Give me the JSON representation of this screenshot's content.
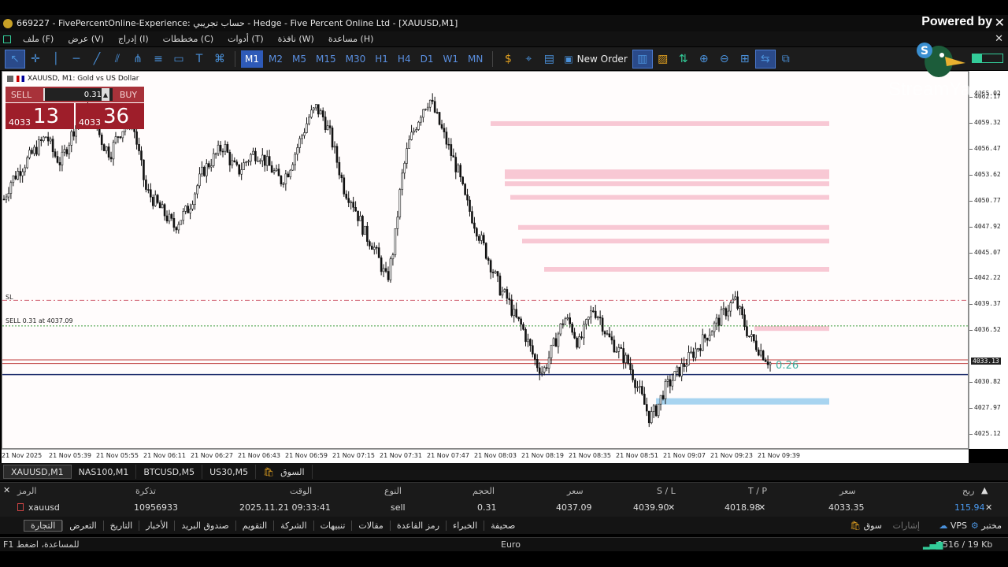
{
  "window": {
    "title": "669227 - FivePercentOnline-Experience: حساب تجريبي - Hedge - Five Percent Online Ltd - [XAUUSD,M1]",
    "overlay_powered": "Powered by",
    "overlay_watermark": "StreamYard"
  },
  "menu": {
    "items": [
      "ملف (F)",
      "عرض (V)",
      "إدراج (I)",
      "مخططات (C)",
      "أدوات (T)",
      "نافذة (W)",
      "مساعدة (H)"
    ]
  },
  "toolbar": {
    "timeframes": [
      "M1",
      "M2",
      "M5",
      "M15",
      "M30",
      "H1",
      "H4",
      "D1",
      "W1",
      "MN"
    ],
    "active_timeframe": "M1",
    "new_order_label": "New Order"
  },
  "chart": {
    "symbol_label": "XAUUSD, M1:  Gold vs US Dollar",
    "sell_label": "SELL",
    "buy_label": "BUY",
    "lot": "0.31",
    "sell_price_small": "4033",
    "sell_price_big": "13",
    "buy_price_small": "4033",
    "buy_price_big": "36",
    "sl_label": "SL",
    "order_label": "SELL 0.31 at 4037.09",
    "countdown": "0:26",
    "price_labels": [
      "4062.17",
      "4059.32",
      "4056.47",
      "4053.62",
      "4050.77",
      "4047.92",
      "4045.07",
      "4042.22",
      "4039.37",
      "4036.52",
      "4030.82",
      "4027.97",
      "4025.12"
    ],
    "current_price_tag": "4033.13",
    "time_labels": [
      "21 Nov 2025",
      "21 Nov 05:39",
      "21 Nov 05:55",
      "21 Nov 06:11",
      "21 Nov 06:27",
      "21 Nov 06:43",
      "21 Nov 06:59",
      "21 Nov 07:15",
      "21 Nov 07:31",
      "21 Nov 07:47",
      "21 Nov 08:03",
      "21 Nov 08:19",
      "21 Nov 08:35",
      "21 Nov 08:51",
      "21 Nov 09:07",
      "21 Nov 09:23",
      "21 Nov 09:39"
    ]
  },
  "chart_data": {
    "type": "candlestick",
    "symbol": "XAUUSD",
    "timeframe": "M1",
    "ylim": [
      4023.5,
      4065.0
    ],
    "sl_price": 4039.9,
    "entry_price": 4037.09,
    "bid": 4033.13,
    "ask": 4033.36,
    "close_path": [
      4051,
      4053,
      4054,
      4055,
      4056,
      4057,
      4058,
      4056,
      4055,
      4057,
      4059,
      4060,
      4061,
      4059,
      4057,
      4056,
      4058,
      4059,
      4060,
      4056,
      4052,
      4051,
      4050,
      4049,
      4048,
      4049,
      4050,
      4052,
      4054,
      4055,
      4056,
      4057,
      4055,
      4054,
      4055,
      4056,
      4056,
      4055,
      4054,
      4053,
      4054,
      4056,
      4058,
      4060,
      4061,
      4060,
      4058,
      4055,
      4052,
      4051,
      4049,
      4047,
      4046,
      4044,
      4042,
      4046,
      4053,
      4057,
      4059,
      4061,
      4062,
      4060,
      4058,
      4056,
      4054,
      4051,
      4049,
      4047,
      4045,
      4043,
      4041,
      4040,
      4038,
      4037,
      4035,
      4033,
      4032,
      4034,
      4036,
      4038,
      4037,
      4035,
      4037,
      4039,
      4038,
      4036,
      4035,
      4034,
      4033,
      4031,
      4029,
      4027,
      4028,
      4030,
      4031,
      4032,
      4033,
      4034,
      4035,
      4036,
      4037,
      4038,
      4039,
      4040,
      4038,
      4036,
      4035,
      4034,
      4033
    ],
    "order_zones": [
      4059.3,
      4054.0,
      4052.7,
      4051.2,
      4047.9,
      4046.4,
      4043.3,
      4036.8
    ],
    "blue_zone": 4028.8
  },
  "tabs": {
    "items": [
      "XAUUSD,M1",
      "NAS100,M1",
      "BTCUSD,M5",
      "US30,M5",
      "السوق"
    ]
  },
  "positions": {
    "headers": [
      "الرمز",
      "تذكرة",
      "الوقت",
      "النوع",
      "الحجم",
      "سعر",
      "S / L",
      "T / P",
      "سعر",
      "ربح"
    ],
    "row": [
      "xauusd",
      "10956933",
      "2025.11.21 09:33:41",
      "sell",
      "0.31",
      "4037.09",
      "4039.90",
      "4018.98",
      "4033.35",
      "115.94"
    ]
  },
  "bottom_tabs": {
    "items": [
      "التجارة",
      "التعرض",
      "التاريخ",
      "الأخبار",
      "صندوق البريد",
      "التقويم",
      "الشركة",
      "تنبيهات",
      "مقالات",
      "رمز القاعدة",
      "الخبراء",
      "صحيفة"
    ],
    "right": [
      "سوق",
      "إشارات",
      "VPS",
      "مختبر"
    ]
  },
  "status": {
    "help": "F1 للمساعدة، اضغط",
    "profile": "Euro",
    "traffic": "9516 / 19 Kb"
  }
}
